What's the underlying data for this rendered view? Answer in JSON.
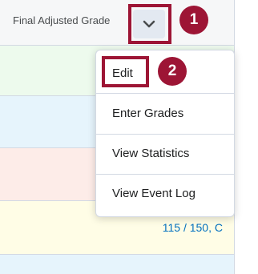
{
  "column_header": {
    "title": "Final Adjusted Grade",
    "chevron_icon": "chevron-down-icon"
  },
  "menu": {
    "items": [
      {
        "label": "Edit"
      },
      {
        "label": "Enter Grades"
      },
      {
        "label": "View Statistics"
      },
      {
        "label": "View Event Log"
      }
    ]
  },
  "annotations": {
    "badge_1": "1",
    "badge_2": "2",
    "color": "#9d1535"
  },
  "rows": [
    {
      "color": "#edfaed",
      "grade": ""
    },
    {
      "color": "#e6f4fc",
      "grade": ""
    },
    {
      "color": "#fdece8",
      "grade": ""
    },
    {
      "color": "#fffde6",
      "grade": "115 / 150, C"
    },
    {
      "color": "#e6f4fc",
      "grade": ""
    }
  ]
}
